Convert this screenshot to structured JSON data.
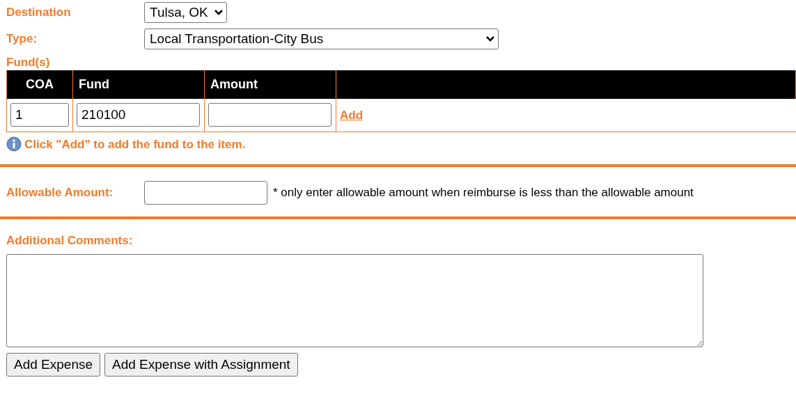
{
  "destination": {
    "label": "Destination",
    "value": "Tulsa, OK"
  },
  "type": {
    "label": "Type:",
    "value": "Local Transportation-City Bus"
  },
  "funds": {
    "label": "Fund(s)",
    "columns": [
      "COA",
      "Fund",
      "Amount"
    ],
    "rows": [
      {
        "coa": "1",
        "fund": "210100",
        "amount": ""
      }
    ],
    "add_link": "Add",
    "hint": "Click \"Add\" to add the fund to the item."
  },
  "allowable": {
    "label": "Allowable Amount:",
    "note": "* only enter allowable amount when reimburse is less than the allowable amount"
  },
  "comments": {
    "label": "Additional Comments:"
  },
  "buttons": [
    "Add Expense",
    "Add Expense with Assignment"
  ]
}
